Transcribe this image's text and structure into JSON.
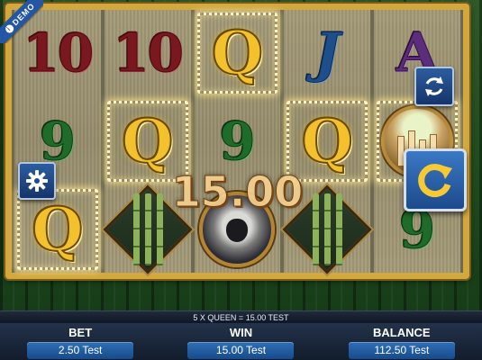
{
  "demo_badge": {
    "label": "DEMO",
    "icon": "info-icon"
  },
  "win_overlay": {
    "amount": "15.00"
  },
  "reels": [
    [
      "10",
      "9",
      "Q"
    ],
    [
      "10",
      "Q",
      "bamboo"
    ],
    [
      "Q",
      "9",
      "monkey"
    ],
    [
      "J",
      "Q",
      "bamboo"
    ],
    [
      "A",
      "temple",
      "9"
    ]
  ],
  "winning_positions": [
    [
      0,
      2
    ],
    [
      1,
      1
    ],
    [
      2,
      0
    ],
    [
      3,
      1
    ],
    [
      4,
      1
    ]
  ],
  "buttons": {
    "settings_icon": "gear-icon",
    "autoplay_icon": "refresh-icon",
    "spin_icon": "spin-arrow-icon"
  },
  "status": {
    "message": "5 X QUEEN = 15.00 TEST"
  },
  "footer": {
    "bet_label": "BET",
    "bet_value": "2.50 Test",
    "win_label": "WIN",
    "win_value": "15.00 Test",
    "balance_label": "BALANCE",
    "balance_value": "112.50 Test"
  },
  "colors": {
    "frame_gold": "#d2a73e",
    "button_blue": "#1c4b8c",
    "symbol_queen": "#f2c12c",
    "symbol_ten": "#7a1820",
    "symbol_nine": "#1f6b2a",
    "symbol_jack": "#1f4f8a",
    "symbol_ace": "#5b2d7a"
  }
}
